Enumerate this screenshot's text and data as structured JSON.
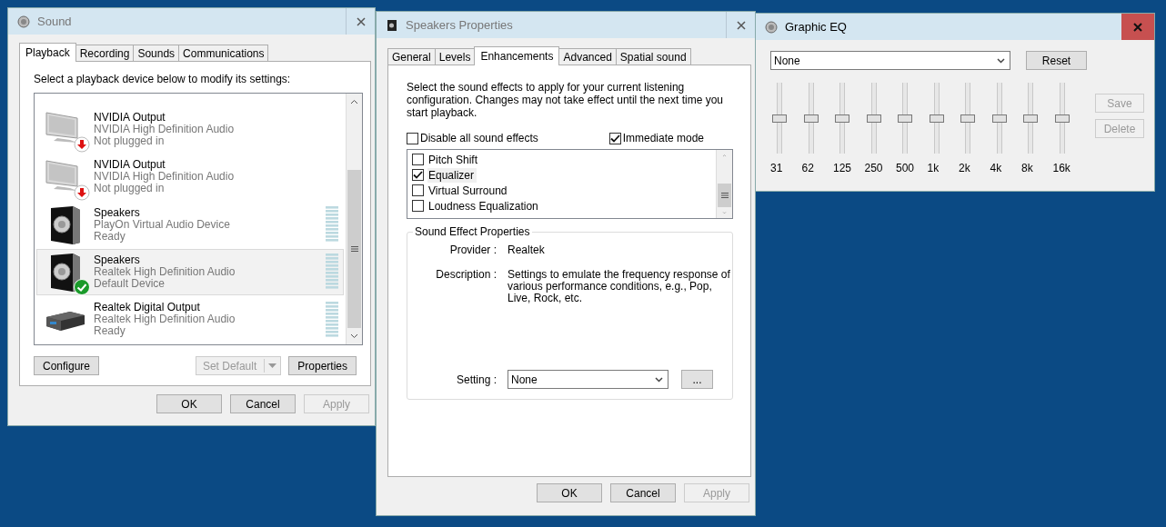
{
  "sound_window": {
    "title": "Sound",
    "tabs": [
      {
        "label": "Playback",
        "selected": true
      },
      {
        "label": "Recording",
        "selected": false
      },
      {
        "label": "Sounds",
        "selected": false
      },
      {
        "label": "Communications",
        "selected": false
      }
    ],
    "instruction": "Select a playback device below to modify its settings:",
    "devices": [
      {
        "name": "NVIDIA Output",
        "driver": "NVIDIA High Definition Audio",
        "status": "Not plugged in",
        "kind": "monitor_unplugged",
        "meter": false,
        "selected": false
      },
      {
        "name": "NVIDIA Output",
        "driver": "NVIDIA High Definition Audio",
        "status": "Not plugged in",
        "kind": "monitor_unplugged",
        "meter": false,
        "selected": false
      },
      {
        "name": "Speakers",
        "driver": "PlayOn Virtual Audio Device",
        "status": "Ready",
        "kind": "speaker",
        "meter": true,
        "selected": false
      },
      {
        "name": "Speakers",
        "driver": "Realtek High Definition Audio",
        "status": "Default Device",
        "kind": "speaker_default",
        "meter": true,
        "selected": true
      },
      {
        "name": "Realtek Digital Output",
        "driver": "Realtek High Definition Audio",
        "status": "Ready",
        "kind": "receiver",
        "meter": true,
        "selected": false
      }
    ],
    "buttons": [
      {
        "label": "Configure",
        "disabled": false,
        "kind": "plain"
      },
      {
        "label": "Set Default",
        "disabled": true,
        "kind": "split"
      },
      {
        "label": "Properties",
        "disabled": false,
        "kind": "plain"
      }
    ],
    "footer_buttons": [
      {
        "label": "OK",
        "disabled": false
      },
      {
        "label": "Cancel",
        "disabled": false
      },
      {
        "label": "Apply",
        "disabled": true
      }
    ]
  },
  "properties_window": {
    "title": "Speakers Properties",
    "tabs": [
      {
        "label": "General",
        "selected": false
      },
      {
        "label": "Levels",
        "selected": false
      },
      {
        "label": "Enhancements",
        "selected": true
      },
      {
        "label": "Advanced",
        "selected": false
      },
      {
        "label": "Spatial sound",
        "selected": false
      }
    ],
    "instruction": "Select the sound effects to apply for your current listening configuration. Changes may not take effect until the next time you start playback.",
    "options": [
      {
        "label": "Disable all sound effects",
        "checked": false
      },
      {
        "label": "Immediate mode",
        "checked": true
      }
    ],
    "effects": [
      {
        "label": "Pitch Shift",
        "checked": false,
        "selected": false
      },
      {
        "label": "Equalizer",
        "checked": true,
        "selected": true
      },
      {
        "label": "Virtual Surround",
        "checked": false,
        "selected": false
      },
      {
        "label": "Loudness Equalization",
        "checked": false,
        "selected": false
      }
    ],
    "group_title": "Sound Effect Properties",
    "provider_label": "Provider :",
    "provider": "Realtek",
    "description_label": "Description :",
    "description": "Settings to emulate the frequency response of various performance conditions,  e.g., Pop, Live, Rock, etc.",
    "setting_label": "Setting :",
    "setting": "None",
    "more_button": "...",
    "footer_buttons": [
      {
        "label": "OK",
        "disabled": false
      },
      {
        "label": "Cancel",
        "disabled": false
      },
      {
        "label": "Apply",
        "disabled": true
      }
    ]
  },
  "eq_window": {
    "title": "Graphic EQ",
    "preset": "None",
    "reset_button": "Reset",
    "bands": [
      {
        "label": "31",
        "level": 0.5
      },
      {
        "label": "62",
        "level": 0.5
      },
      {
        "label": "125",
        "level": 0.5
      },
      {
        "label": "250",
        "level": 0.5
      },
      {
        "label": "500",
        "level": 0.5
      },
      {
        "label": "1k",
        "level": 0.5
      },
      {
        "label": "2k",
        "level": 0.5
      },
      {
        "label": "4k",
        "level": 0.5
      },
      {
        "label": "8k",
        "level": 0.5
      },
      {
        "label": "16k",
        "level": 0.5
      }
    ],
    "side_buttons": [
      {
        "label": "Save",
        "disabled": true
      },
      {
        "label": "Delete",
        "disabled": true
      }
    ]
  }
}
